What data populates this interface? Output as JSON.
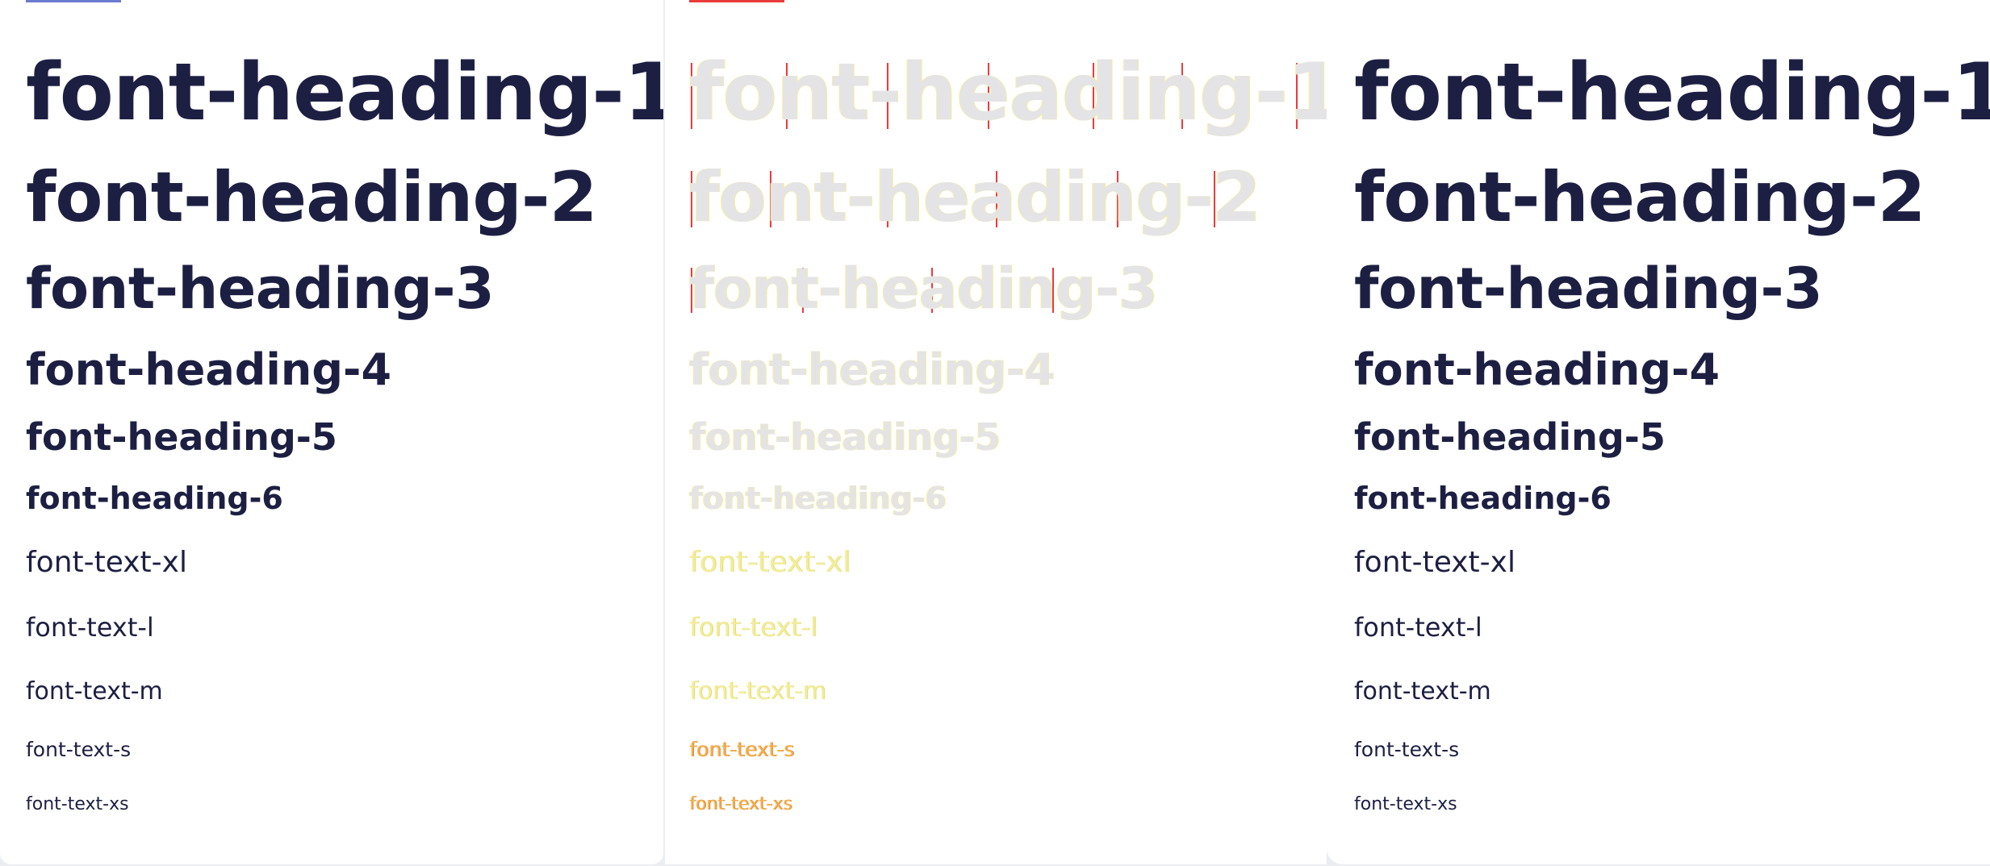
{
  "panels": {
    "left": {
      "items": {
        "h1": "font-heading-1",
        "h2": "font-heading-2",
        "h3": "font-heading-3",
        "h4": "font-heading-4",
        "h5": "font-heading-5",
        "h6": "font-heading-6",
        "xl": "font-text-xl",
        "l": "font-text-l",
        "m": "font-text-m",
        "s": "font-text-s",
        "xs": "font-text-xs"
      }
    },
    "diff": {
      "items": {
        "h1": "font-heading-1",
        "h2": "font-heading-2",
        "h3": "font-heading-3",
        "h4": "font-heading-4",
        "h5": "font-heading-5",
        "h6": "font-heading-6",
        "xl": "font-text-xl",
        "l": "font-text-l",
        "m": "font-text-m",
        "s": "font-text-s",
        "xs": "font-text-xs"
      }
    },
    "right": {
      "items": {
        "h1": "font-heading-1",
        "h2": "font-heading-2",
        "h3": "font-heading-3",
        "h4": "font-heading-4",
        "h5": "font-heading-5",
        "h6": "font-heading-6",
        "xl": "font-text-xl",
        "l": "font-text-l",
        "m": "font-text-m",
        "s": "font-text-s",
        "xs": "font-text-xs"
      }
    }
  },
  "colors": {
    "text": "#1d1f42",
    "background": "#ffffff",
    "canvas": "#ecedf1",
    "left_tab": "#6a7bd0",
    "diff_tab": "#ea3b3b",
    "diff_marker": "#ef3a3a",
    "diff_ghost": "#e4e4e6",
    "diff_highlight": "#f3ee9a"
  }
}
